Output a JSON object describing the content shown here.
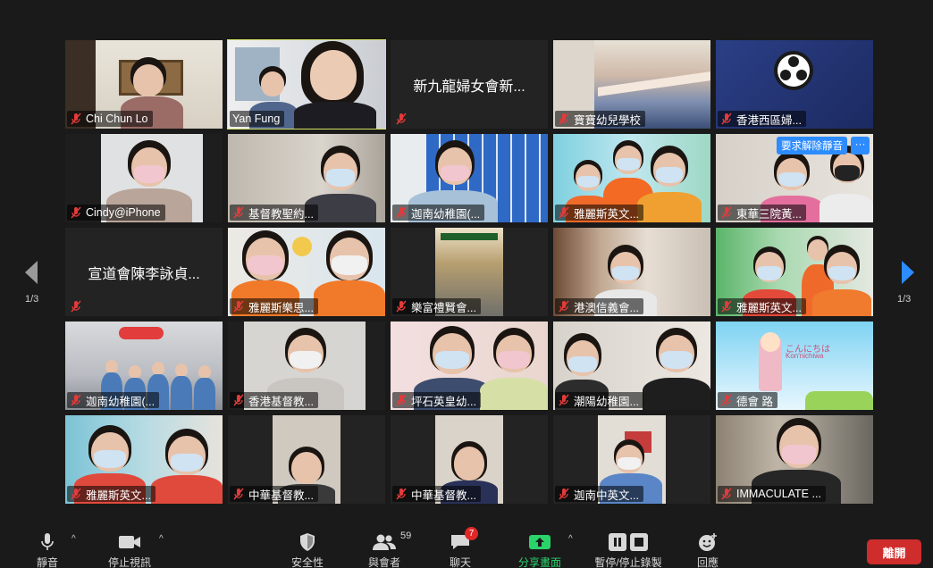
{
  "gallery": {
    "page_indicator_left": "1/3",
    "page_indicator_right": "1/3",
    "request_unmute_label": "要求解除靜音",
    "more_label": "···",
    "tiles": [
      {
        "name": "Chi Chun Lo"
      },
      {
        "name": "Yan Fung"
      },
      {
        "name": "新九龍婦女會新..."
      },
      {
        "name": "寶寶幼兒學校"
      },
      {
        "name": "香港西區婦..."
      },
      {
        "name": "Cindy@iPhone"
      },
      {
        "name": "基督教聖約..."
      },
      {
        "name": "迦南幼稚園(..."
      },
      {
        "name": "雅麗斯英文..."
      },
      {
        "name": "東華三院黃..."
      },
      {
        "name": "宣道會陳李詠貞..."
      },
      {
        "name": "雅麗斯樂思..."
      },
      {
        "name": "樂富禮賢會..."
      },
      {
        "name": "港澳信義會..."
      },
      {
        "name": "雅麗斯英文..."
      },
      {
        "name": "迦南幼稚園(..."
      },
      {
        "name": "香港基督教..."
      },
      {
        "name": "坪石英皇幼..."
      },
      {
        "name": "潮陽幼稚園..."
      },
      {
        "name": "德會 路"
      },
      {
        "name": "雅麗斯英文..."
      },
      {
        "name": "中華基督教..."
      },
      {
        "name": "中華基督教..."
      },
      {
        "name": "迦南中英文..."
      },
      {
        "name": "IMMACULATE ..."
      }
    ],
    "greeting_text": "こんにちは",
    "greeting_romaji": "Kon'nichiwa"
  },
  "toolbar": {
    "mute": "靜音",
    "stop_video": "停止視訊",
    "security": "安全性",
    "participants": "與會者",
    "participants_count": "59",
    "chat": "聊天",
    "chat_badge": "7",
    "share_screen": "分享畫面",
    "pause_recording": "暫停/停止錄製",
    "reactions": "回應",
    "leave": "離開"
  },
  "colors": {
    "accent_blue": "#2d8cff",
    "share_green": "#2bd36b",
    "leave_red": "#cf2c2c",
    "active_speaker": "#d6e36a"
  }
}
